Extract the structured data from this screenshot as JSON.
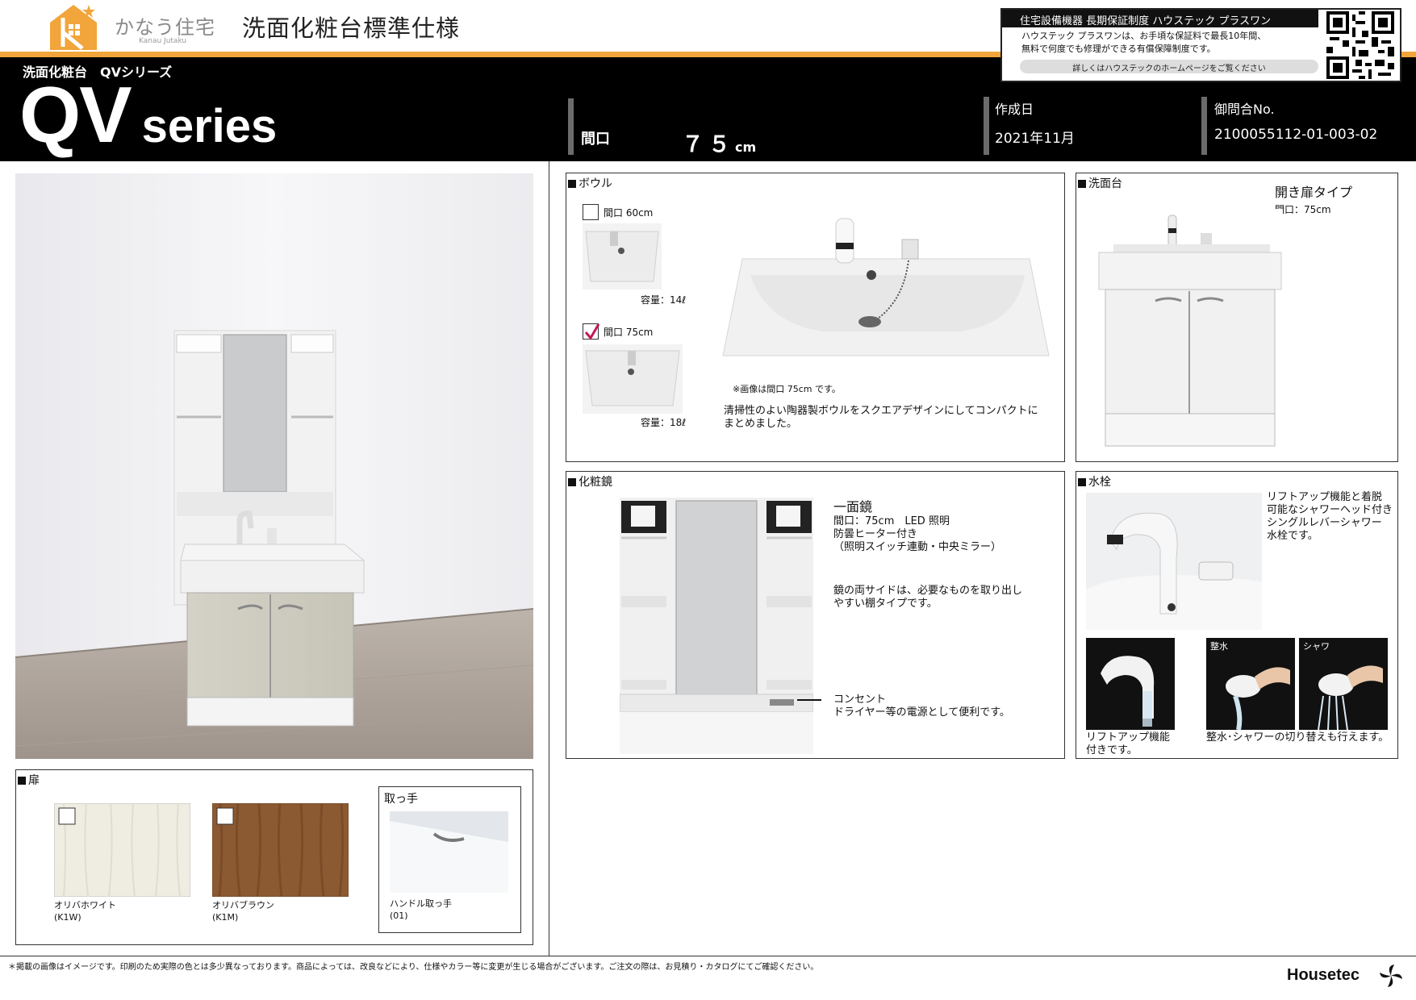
{
  "header": {
    "brand_name": "かなう住宅",
    "brand_roman": "Kanau Jutaku",
    "doc_title": "洗面化粧台標準仕様",
    "series_sub": "洗面化粧台　QVシリーズ",
    "series_qv": "QV",
    "series_word": "series",
    "maguchi_label": "間口",
    "maguchi_value": "７５",
    "maguchi_unit": "cm",
    "date_label": "作成日",
    "date_value": "2021年11月",
    "inquiry_label": "御問合No.",
    "inquiry_value": "2100055112-01-003-02"
  },
  "warranty": {
    "heading": "住宅設備機器 長期保証制度 ハウステック プラスワン",
    "line1": "ハウステック プラスワンは、お手頃な保証料で最長10年間、",
    "line2": "無料で何度でも修理ができる有償保障制度です。",
    "button": "詳しくはハウステックのホームページをご覧ください"
  },
  "bowl": {
    "title": "ボウル",
    "opt1_label": "間口 60cm",
    "opt1_capacity": "容量：14ℓ",
    "opt2_label": "間口 75cm",
    "opt2_capacity": "容量：18ℓ",
    "image_note": "※画像は間口 75cm です。",
    "desc1": "清掃性のよい陶器製ボウルをスクエアデザインにしてコンパクトに",
    "desc2": "まとめました。"
  },
  "counter": {
    "title": "洗面台",
    "type": "開き扉タイプ",
    "width": "間口：75cm"
  },
  "mirror": {
    "title": "化粧鏡",
    "name": "一面鏡",
    "spec1": "間口：75cm　LED 照明",
    "spec2": "防曇ヒーター付き",
    "spec3": "（照明スイッチ連動・中央ミラー）",
    "side1": "鏡の両サイドは、必要なものを取り出し",
    "side2": "やすい棚タイプです。",
    "outlet_title": "コンセント",
    "outlet_desc": "ドライヤー等の電源として便利です。"
  },
  "faucet": {
    "title": "水栓",
    "desc1": "リフトアップ機能と着脱",
    "desc2": "可能なシャワーヘッド付き",
    "desc3": "シングルレバーシャワー",
    "desc4": "水栓です。",
    "lift1": "リフトアップ機能",
    "lift2": "付きです。",
    "tag_flow": "整水",
    "tag_shower": "シャワ",
    "switch_desc": "整水･シャワーの切り替えも行えます。"
  },
  "door": {
    "title": "扉",
    "color1_name": "オリバホワイト",
    "color1_code": "(K1W)",
    "color2_name": "オリバブラウン",
    "color2_code": "(K1M)",
    "handle_title": "取っ手",
    "handle_name": "ハンドル取っ手",
    "handle_code": "(01)"
  },
  "footer": {
    "note": "＊掲載の画像はイメージです。印刷のため実際の色とは多少異なっております。商品によっては、改良などにより、仕様やカラー等に変更が生じる場合がございます。ご注文の際は、お見積り・カタログにてご確認ください。",
    "maker": "Housetec"
  },
  "colors": {
    "accent_orange": "#f1a53a",
    "band_black": "#000000",
    "check_mark": "#c2185b"
  }
}
